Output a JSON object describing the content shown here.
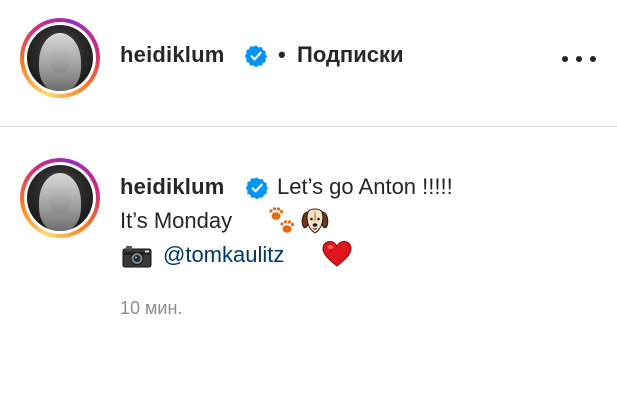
{
  "header": {
    "username": "heidiklum",
    "separator": "•",
    "follow_label": "Подписки"
  },
  "comment": {
    "username": "heidiklum",
    "line1": "Let’s go Anton !!!!!",
    "line2": "It’s Monday",
    "mention": "@tomkaulitz",
    "timestamp": "10 мин."
  },
  "icons": {
    "verified": "verified-badge-icon",
    "more": "more-options-icon",
    "paws": "paw-prints-icon",
    "dog": "dog-face-icon",
    "camera": "camera-icon",
    "heart": "red-heart-icon"
  },
  "colors": {
    "verified_blue": "#0095f6",
    "mention_link": "#00376b",
    "timestamp_gray": "#8e8e8e",
    "heart_red": "#e0151b"
  }
}
